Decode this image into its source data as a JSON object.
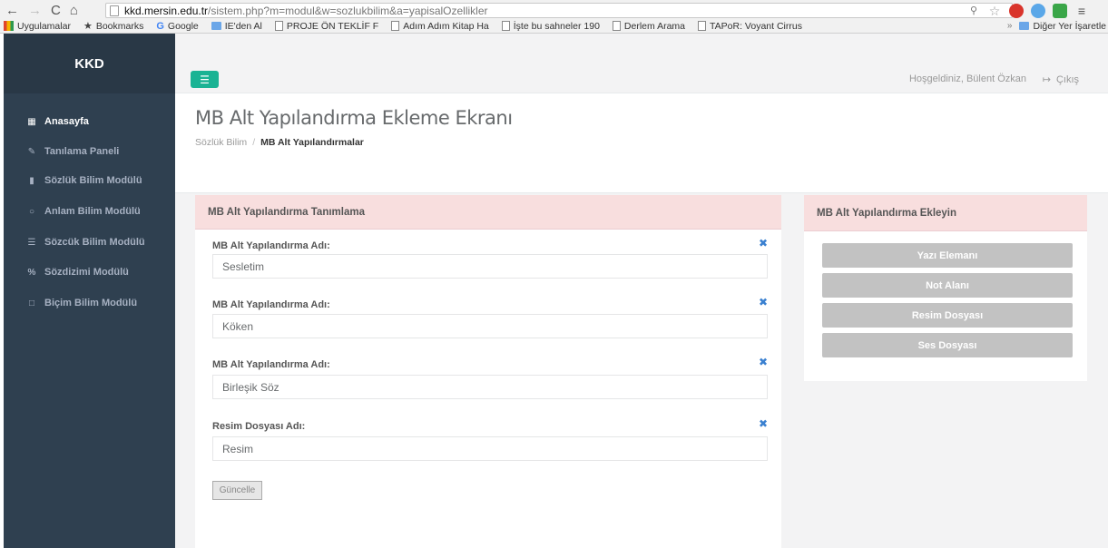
{
  "browser": {
    "url_domain": "kkd.mersin.edu.tr",
    "url_path": "/sistem.php?m=modul&w=sozlukbilim&a=yapisalOzellikler"
  },
  "bookmarks": {
    "items": [
      "Uygulamalar",
      "Bookmarks",
      "Google",
      "IE'den Al",
      "PROJE ÖN TEKLİF F",
      "Adım Adım Kitap Ha",
      "İşte bu sahneler 190",
      "Derlem Arama",
      "TAPoR: Voyant Cirrus"
    ],
    "other": "Diğer Yer İşaretle"
  },
  "sidebar": {
    "brand": "KKD",
    "items": [
      {
        "label": "Anasayfa",
        "icon": "grid-icon"
      },
      {
        "label": "Tanılama Paneli",
        "icon": "pencil-icon"
      },
      {
        "label": "Sözlük Bilim Modülü",
        "icon": "book-icon"
      },
      {
        "label": "Anlam Bilim Modülü",
        "icon": "globe-icon"
      },
      {
        "label": "Sözcük Bilim Modülü",
        "icon": "list-icon"
      },
      {
        "label": "Sözdizimi Modülü",
        "icon": "scissors-icon"
      },
      {
        "label": "Biçim Bilim Modülü",
        "icon": "file-icon"
      }
    ],
    "active_index": 0
  },
  "topbar": {
    "welcome": "Hoşgeldiniz, Bülent Özkan",
    "logout": "Çıkış"
  },
  "heading": {
    "title": "MB Alt Yapılandırma Ekleme Ekranı",
    "breadcrumb_parent": "Sözlük Bilim",
    "breadcrumb_current": "MB Alt Yapılandırmalar"
  },
  "left_panel": {
    "title": "MB Alt Yapılandırma Tanımlama",
    "fields": [
      {
        "label": "MB Alt Yapılandırma Adı:",
        "value": "Sesletim"
      },
      {
        "label": "MB Alt Yapılandırma Adı:",
        "value": "Köken"
      },
      {
        "label": "MB Alt Yapılandırma Adı:",
        "value": "Birleşik Söz"
      },
      {
        "label": "Resim Dosyası Adı:",
        "value": "Resim"
      }
    ],
    "update_label": "Güncelle"
  },
  "right_panel": {
    "title": "MB Alt Yapılandırma Ekleyin",
    "buttons": [
      "Yazı Elemanı",
      "Not Alanı",
      "Resim Dosyası",
      "Ses Dosyası"
    ]
  },
  "colors": {
    "sidebar_bg": "#2f4050",
    "accent": "#1ab394",
    "panel_head": "#f8dede"
  }
}
